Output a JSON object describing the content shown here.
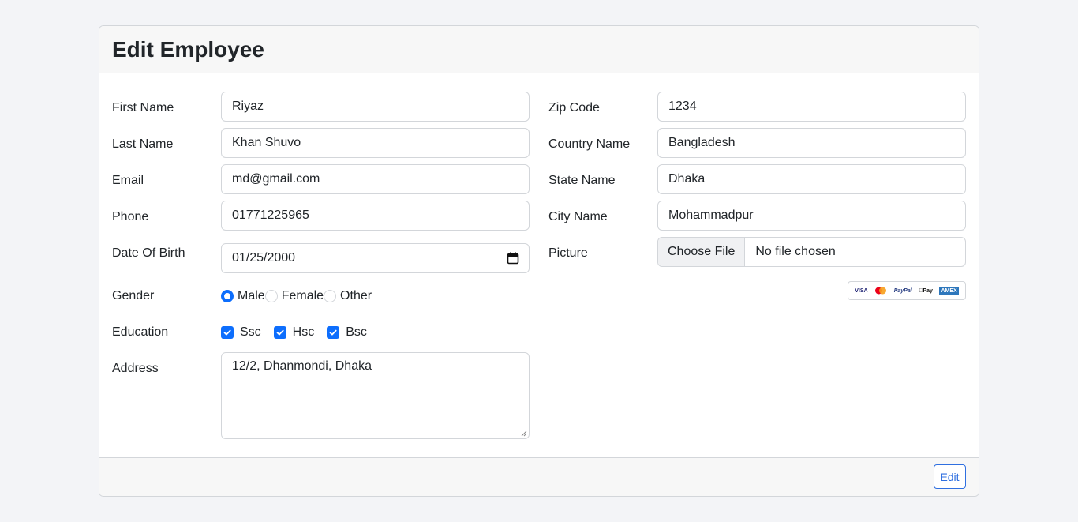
{
  "header": {
    "title": "Edit Employee"
  },
  "form": {
    "first_name": {
      "label": "First Name",
      "value": "Riyaz"
    },
    "last_name": {
      "label": "Last Name",
      "value": "Khan Shuvo"
    },
    "email": {
      "label": "Email",
      "value": "md@gmail.com"
    },
    "phone": {
      "label": "Phone",
      "value": "01771225965"
    },
    "dob": {
      "label": "Date Of Birth",
      "value": "01/25/2000"
    },
    "gender": {
      "label": "Gender",
      "options": [
        "Male",
        "Female",
        "Other"
      ],
      "selected": "Male"
    },
    "education": {
      "label": "Education",
      "options": [
        "Ssc",
        "Hsc",
        "Bsc"
      ]
    },
    "address": {
      "label": "Address",
      "value": "12/2, Dhanmondi, Dhaka"
    },
    "zip": {
      "label": "Zip Code",
      "value": "1234"
    },
    "country": {
      "label": "Country Name",
      "value": "Bangladesh"
    },
    "state": {
      "label": "State Name",
      "value": "Dhaka"
    },
    "city": {
      "label": "City Name",
      "value": "Mohammadpur"
    },
    "picture": {
      "label": "Picture",
      "button": "Choose File",
      "status": "No file chosen"
    }
  },
  "payment_icons": [
    "VISA",
    "mastercard",
    "PayPal",
    "Pay",
    "AMEX"
  ],
  "footer": {
    "edit_label": "Edit"
  },
  "colors": {
    "accent": "#0d6efd",
    "button_border": "#2f6fe0",
    "background": "#f3f4f7"
  }
}
